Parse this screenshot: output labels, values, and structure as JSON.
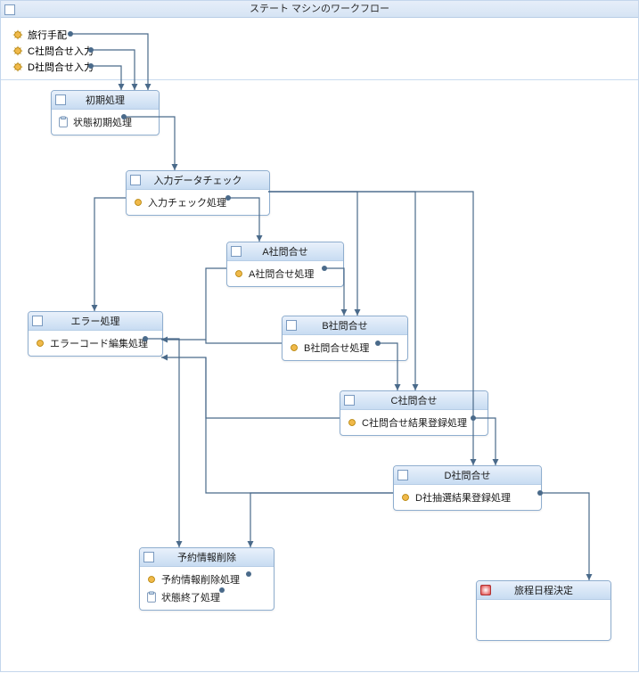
{
  "title": "ステート マシンのワークフロー",
  "inputs": [
    {
      "label": "旅行手配"
    },
    {
      "label": "C社問合せ入力"
    },
    {
      "label": "D社問合せ入力"
    }
  ],
  "states": {
    "initial": {
      "title": "初期処理",
      "activities": [
        {
          "label": "状態初期処理"
        }
      ]
    },
    "inputCheck": {
      "title": "入力データチェック",
      "activities": [
        {
          "label": "入力チェック処理"
        }
      ]
    },
    "aInquiry": {
      "title": "A社問合せ",
      "activities": [
        {
          "label": "A社問合せ処理"
        }
      ]
    },
    "error": {
      "title": "エラー処理",
      "activities": [
        {
          "label": "エラーコード編集処理"
        }
      ]
    },
    "bInquiry": {
      "title": "B社問合せ",
      "activities": [
        {
          "label": "B社問合せ処理"
        }
      ]
    },
    "cInquiry": {
      "title": "C社問合せ",
      "activities": [
        {
          "label": "C社問合せ結果登録処理"
        }
      ]
    },
    "dInquiry": {
      "title": "D社問合せ",
      "activities": [
        {
          "label": "D社抽選結果登録処理"
        }
      ]
    },
    "deleteReservation": {
      "title": "予約情報削除",
      "activities": [
        {
          "label": "予約情報削除処理"
        },
        {
          "label": "状態終了処理"
        }
      ]
    },
    "itinerary": {
      "title": "旅程日程決定"
    }
  },
  "chart_data": {
    "type": "diagram",
    "title": "ステート マシンのワークフロー",
    "inputs": [
      "旅行手配",
      "C社問合せ入力",
      "D社問合せ入力"
    ],
    "nodes": [
      {
        "id": "initial",
        "label": "初期処理",
        "activities": [
          "状態初期処理"
        ]
      },
      {
        "id": "inputCheck",
        "label": "入力データチェック",
        "activities": [
          "入力チェック処理"
        ]
      },
      {
        "id": "aInquiry",
        "label": "A社問合せ",
        "activities": [
          "A社問合せ処理"
        ]
      },
      {
        "id": "error",
        "label": "エラー処理",
        "activities": [
          "エラーコード編集処理"
        ]
      },
      {
        "id": "bInquiry",
        "label": "B社問合せ",
        "activities": [
          "B社問合せ処理"
        ]
      },
      {
        "id": "cInquiry",
        "label": "C社問合せ",
        "activities": [
          "C社問合せ結果登録処理"
        ]
      },
      {
        "id": "dInquiry",
        "label": "D社問合せ",
        "activities": [
          "D社抽選結果登録処理"
        ]
      },
      {
        "id": "deleteReservation",
        "label": "予約情報削除",
        "activities": [
          "予約情報削除処理",
          "状態終了処理"
        ]
      },
      {
        "id": "itinerary",
        "label": "旅程日程決定",
        "final": true
      }
    ],
    "edges": [
      {
        "from": "旅行手配",
        "to": "initial"
      },
      {
        "from": "C社問合せ入力",
        "to": "initial"
      },
      {
        "from": "D社問合せ入力",
        "to": "initial"
      },
      {
        "from": "initial",
        "to": "inputCheck"
      },
      {
        "from": "inputCheck",
        "to": "aInquiry"
      },
      {
        "from": "inputCheck",
        "to": "error"
      },
      {
        "from": "inputCheck",
        "to": "bInquiry"
      },
      {
        "from": "inputCheck",
        "to": "cInquiry"
      },
      {
        "from": "inputCheck",
        "to": "dInquiry"
      },
      {
        "from": "aInquiry",
        "to": "bInquiry"
      },
      {
        "from": "aInquiry",
        "to": "error"
      },
      {
        "from": "bInquiry",
        "to": "cInquiry"
      },
      {
        "from": "bInquiry",
        "to": "error"
      },
      {
        "from": "cInquiry",
        "to": "dInquiry"
      },
      {
        "from": "cInquiry",
        "to": "error"
      },
      {
        "from": "dInquiry",
        "to": "itinerary"
      },
      {
        "from": "dInquiry",
        "to": "deleteReservation"
      },
      {
        "from": "dInquiry",
        "to": "error"
      },
      {
        "from": "error",
        "to": "deleteReservation"
      }
    ]
  }
}
